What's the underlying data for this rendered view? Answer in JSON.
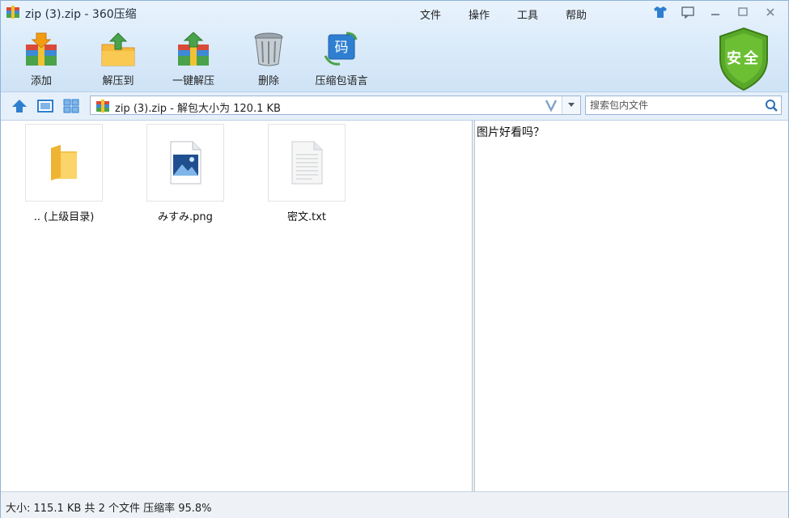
{
  "window": {
    "title": "zip (3).zip - 360压缩",
    "menu": [
      "文件",
      "操作",
      "工具",
      "帮助"
    ]
  },
  "toolbar": {
    "items": [
      {
        "label": "添加",
        "icon": "add-archive-icon"
      },
      {
        "label": "解压到",
        "icon": "extract-to-icon"
      },
      {
        "label": "一键解压",
        "icon": "one-click-extract-icon"
      },
      {
        "label": "删除",
        "icon": "trash-icon"
      },
      {
        "label": "压缩包语言",
        "icon": "encoding-icon"
      }
    ],
    "security_badge": "安全"
  },
  "address": {
    "path_text": "zip (3).zip - 解包大小为 120.1 KB"
  },
  "search": {
    "placeholder": "搜索包内文件"
  },
  "files": [
    {
      "name": ".. (上级目录)",
      "icon": "folder-up-icon"
    },
    {
      "name": "みすみ.png",
      "icon": "image-file-icon"
    },
    {
      "name": "密文.txt",
      "icon": "text-file-icon"
    }
  ],
  "preview": {
    "content": "图片好看吗？"
  },
  "status": {
    "text": "大小: 115.1 KB 共 2 个文件 压缩率 95.8%"
  }
}
